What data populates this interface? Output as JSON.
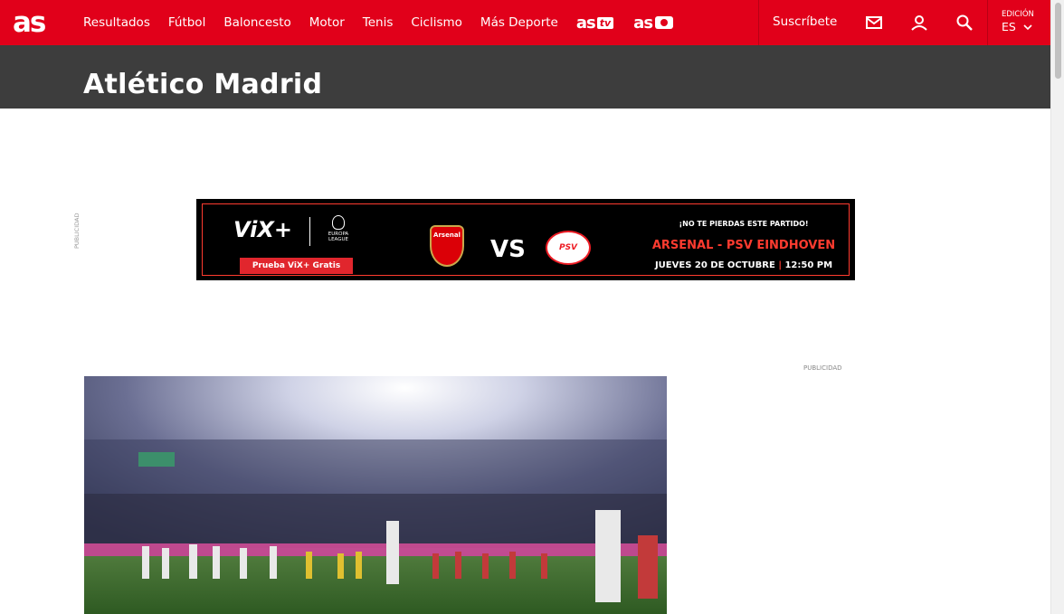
{
  "header": {
    "logo": "as",
    "nav": [
      "Resultados",
      "Fútbol",
      "Baloncesto",
      "Motor",
      "Tenis",
      "Ciclismo",
      "Más Deporte"
    ],
    "brand_tv": {
      "text": "as",
      "badge": "tv"
    },
    "brand_photo": {
      "text": "as"
    },
    "subscribe": "Suscríbete",
    "edition_label": "EDICIÓN",
    "edition_value": "ES",
    "icons": [
      "mail-icon",
      "user-icon",
      "search-icon",
      "chevron-down-icon"
    ],
    "colors": {
      "accent": "#e1001a",
      "band": "#3d3d3d"
    }
  },
  "page": {
    "title": "Atlético Madrid"
  },
  "ads": {
    "label": "PUBLICIDAD",
    "banner": {
      "brand": "ViX+",
      "league": "EUROPA LEAGUE",
      "cta": "Prueba ViX+ Gratis",
      "home": "Arsenal",
      "vs": "VS",
      "away": "PSV",
      "headline": "¡NO TE PIERDAS ESTE PARTIDO!",
      "match": "ARSENAL - PSV EINDHOVEN",
      "date": "JUEVES 20 DE OCTUBRE",
      "time": "12:50 PM"
    }
  }
}
